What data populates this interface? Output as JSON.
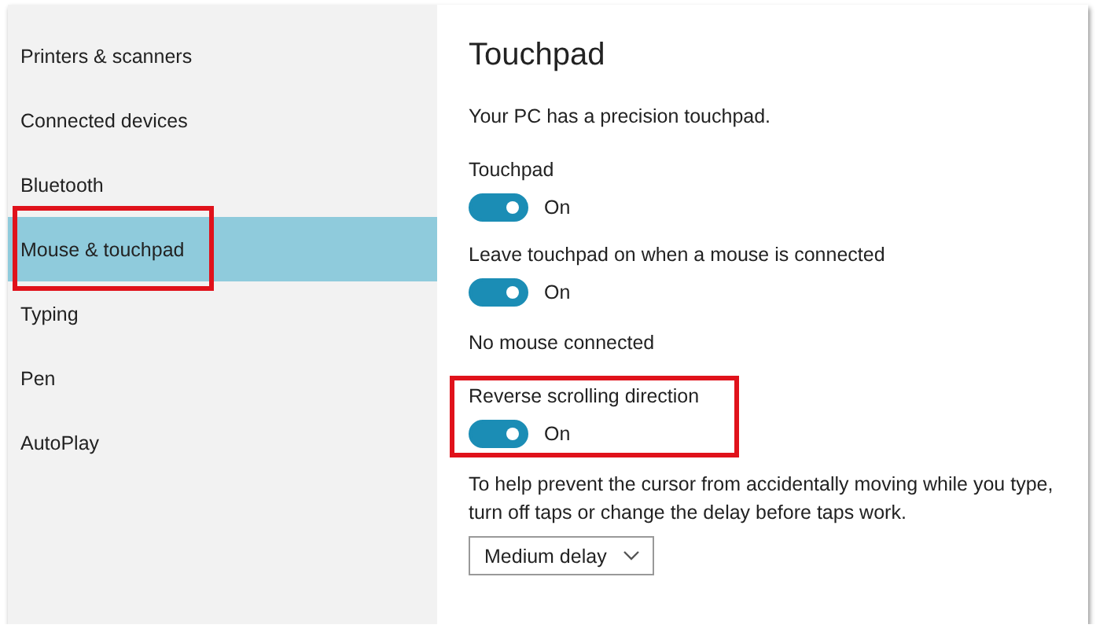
{
  "sidebar": {
    "items": [
      {
        "label": "Printers & scanners",
        "selected": false,
        "highlighted": false
      },
      {
        "label": "Connected devices",
        "selected": false,
        "highlighted": false
      },
      {
        "label": "Bluetooth",
        "selected": false,
        "highlighted": false
      },
      {
        "label": "Mouse & touchpad",
        "selected": true,
        "highlighted": true
      },
      {
        "label": "Typing",
        "selected": false,
        "highlighted": false
      },
      {
        "label": "Pen",
        "selected": false,
        "highlighted": false
      },
      {
        "label": "AutoPlay",
        "selected": false,
        "highlighted": false
      }
    ]
  },
  "content": {
    "title": "Touchpad",
    "subtitle": "Your PC has a precision touchpad.",
    "sections": [
      {
        "kind": "toggle",
        "label": "Touchpad",
        "on": true,
        "state_text": "On",
        "highlighted": false
      },
      {
        "kind": "toggle",
        "label": "Leave touchpad on when a mouse is connected",
        "on": true,
        "state_text": "On",
        "highlighted": false
      },
      {
        "kind": "note",
        "text": "No mouse connected"
      },
      {
        "kind": "toggle",
        "label": "Reverse scrolling direction",
        "on": true,
        "state_text": "On",
        "highlighted": true
      },
      {
        "kind": "dropdown",
        "text": "To help prevent the cursor from accidentally moving while you type, turn off taps or change the delay before taps work.",
        "value": "Medium delay"
      }
    ]
  }
}
